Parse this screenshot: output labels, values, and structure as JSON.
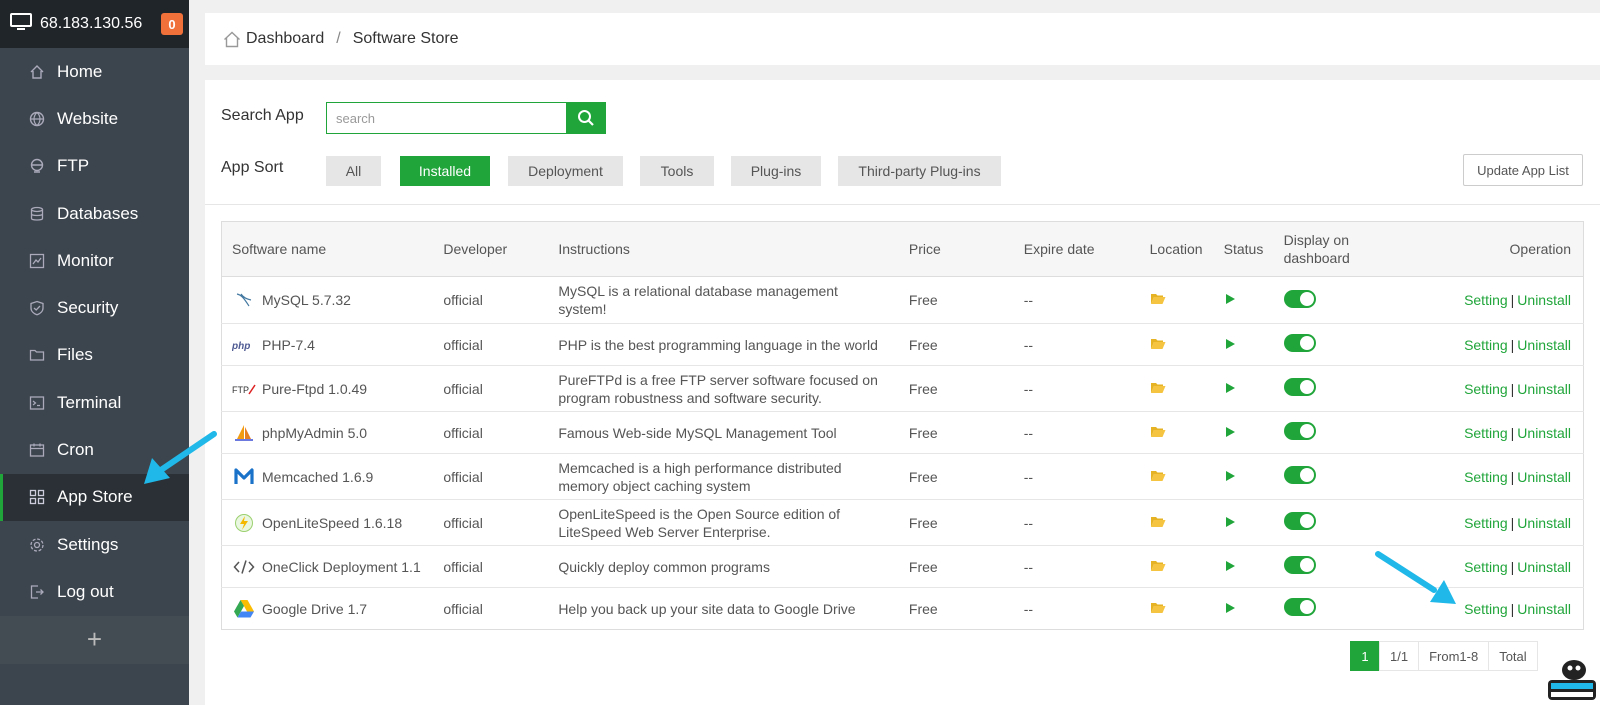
{
  "sidebar": {
    "ip": "68.183.130.56",
    "badge": "0",
    "items": [
      {
        "label": "Home",
        "icon": "home-icon"
      },
      {
        "label": "Website",
        "icon": "globe-icon"
      },
      {
        "label": "FTP",
        "icon": "ftp-icon"
      },
      {
        "label": "Databases",
        "icon": "database-icon"
      },
      {
        "label": "Monitor",
        "icon": "monitor-icon"
      },
      {
        "label": "Security",
        "icon": "shield-icon"
      },
      {
        "label": "Files",
        "icon": "folder-icon"
      },
      {
        "label": "Terminal",
        "icon": "terminal-icon"
      },
      {
        "label": "Cron",
        "icon": "calendar-icon"
      },
      {
        "label": "App Store",
        "icon": "grid-icon",
        "active": true
      },
      {
        "label": "Settings",
        "icon": "gear-icon"
      },
      {
        "label": "Log out",
        "icon": "logout-icon"
      }
    ],
    "plus": "+"
  },
  "breadcrumb": {
    "home": "Dashboard",
    "separator": "/",
    "current": "Software Store"
  },
  "search": {
    "label": "Search App",
    "placeholder": "search"
  },
  "sort": {
    "label": "App Sort",
    "options": [
      "All",
      "Installed",
      "Deployment",
      "Tools",
      "Plug-ins",
      "Third-party Plug-ins"
    ],
    "active": "Installed"
  },
  "update_button": "Update App List",
  "table": {
    "headers": [
      "Software name",
      "Developer",
      "Instructions",
      "Price",
      "Expire date",
      "Location",
      "Status",
      "Display on dashboard",
      "Operation"
    ],
    "rows": [
      {
        "name": "MySQL 5.7.32",
        "icon": "mysql-icon",
        "developer": "official",
        "instructions": "MySQL is a relational database management system!",
        "price": "Free",
        "expire": "--"
      },
      {
        "name": "PHP-7.4",
        "icon": "php-icon",
        "developer": "official",
        "instructions": "PHP is the best programming language in the world",
        "price": "Free",
        "expire": "--"
      },
      {
        "name": "Pure-Ftpd 1.0.49",
        "icon": "ftp-logo-icon",
        "developer": "official",
        "instructions": "PureFTPd is a free FTP server software focused on program robustness and software security.",
        "price": "Free",
        "expire": "--"
      },
      {
        "name": "phpMyAdmin 5.0",
        "icon": "phpmyadmin-icon",
        "developer": "official",
        "instructions": "Famous Web-side MySQL Management Tool",
        "price": "Free",
        "expire": "--"
      },
      {
        "name": "Memcached 1.6.9",
        "icon": "memcached-icon",
        "developer": "official",
        "instructions": "Memcached is a high performance distributed memory object caching system",
        "price": "Free",
        "expire": "--"
      },
      {
        "name": "OpenLiteSpeed 1.6.18",
        "icon": "litespeed-icon",
        "developer": "official",
        "instructions": "OpenLiteSpeed is the Open Source edition of LiteSpeed Web Server Enterprise.",
        "price": "Free",
        "expire": "--"
      },
      {
        "name": "OneClick Deployment 1.1",
        "icon": "code-icon",
        "developer": "official",
        "instructions": "Quickly deploy common programs",
        "price": "Free",
        "expire": "--"
      },
      {
        "name": "Google Drive 1.7",
        "icon": "google-drive-icon",
        "developer": "official",
        "instructions": "Help you back up your site data to Google Drive",
        "price": "Free",
        "expire": "--"
      }
    ],
    "op_setting": "Setting",
    "op_separator": "|",
    "op_uninstall": "Uninstall"
  },
  "pagination": {
    "current": "1",
    "pages": "1/1",
    "range": "From1-8",
    "total": "Total"
  },
  "colors": {
    "accent": "#20a53a",
    "sidebar": "#3c444d",
    "badge": "#f0713a",
    "arrow": "#1fb8e8",
    "folder": "#f5c542"
  }
}
